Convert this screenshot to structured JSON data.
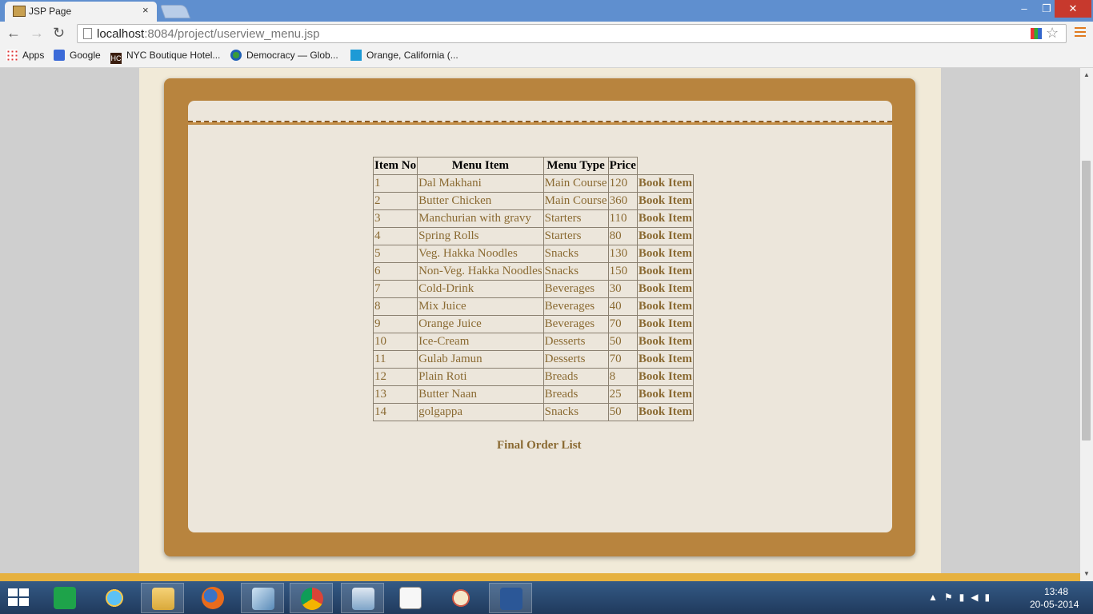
{
  "browser": {
    "tab_title": "JSP Page",
    "tab_close": "×",
    "url_host": "localhost",
    "url_path": ":8084/project/userview_menu.jsp",
    "window_controls": {
      "minimize": "–",
      "maximize": "❐",
      "close": "✕"
    }
  },
  "bookmarks": [
    {
      "label": "Apps",
      "icon": "apps-grid-icon"
    },
    {
      "label": "Google",
      "icon": "google-icon"
    },
    {
      "label": "NYC Boutique Hotel...",
      "icon": "hc-icon"
    },
    {
      "label": "Democracy — Glob...",
      "icon": "globe-icon"
    },
    {
      "label": "Orange, California (...",
      "icon": "f-icon"
    }
  ],
  "menu": {
    "headers": [
      "Item No",
      "Menu Item",
      "Menu Type",
      "Price"
    ],
    "book_label": "Book Item",
    "rows": [
      [
        "1",
        "Dal Makhani",
        "Main Course",
        "120"
      ],
      [
        "2",
        "Butter Chicken",
        "Main Course",
        "360"
      ],
      [
        "3",
        "Manchurian with gravy",
        "Starters",
        "110"
      ],
      [
        "4",
        "Spring Rolls",
        "Starters",
        "80"
      ],
      [
        "5",
        "Veg. Hakka Noodles",
        "Snacks",
        "130"
      ],
      [
        "6",
        "Non-Veg. Hakka Noodles",
        "Snacks",
        "150"
      ],
      [
        "7",
        "Cold-Drink",
        "Beverages",
        "30"
      ],
      [
        "8",
        "Mix Juice",
        "Beverages",
        "40"
      ],
      [
        "9",
        "Orange Juice",
        "Beverages",
        "70"
      ],
      [
        "10",
        "Ice-Cream",
        "Desserts",
        "50"
      ],
      [
        "11",
        "Gulab Jamun",
        "Desserts",
        "70"
      ],
      [
        "12",
        "Plain Roti",
        "Breads",
        "8"
      ],
      [
        "13",
        "Butter Naan",
        "Breads",
        "25"
      ],
      [
        "14",
        "golgappa",
        "Snacks",
        "50"
      ]
    ],
    "final_order_label": "Final Order List"
  },
  "taskbar": {
    "apps": [
      "windows-store",
      "internet-explorer",
      "file-explorer",
      "firefox",
      "virtualbox",
      "chrome",
      "remote-desktop",
      "notepad",
      "paint",
      "word"
    ],
    "clock_time": "13:48",
    "clock_date": "20-05-2014"
  },
  "colors": {
    "board": "#b8843e",
    "panel": "#ece6db",
    "link_text": "#8a6a32"
  }
}
